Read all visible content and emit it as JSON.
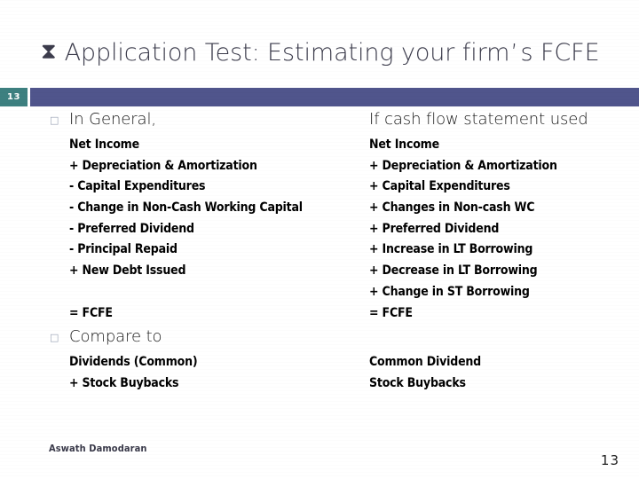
{
  "colors": {
    "header_bar": "#50558C",
    "slide_badge": "#3D8080",
    "title_text": "#3A3A4A",
    "body_text": "#000000",
    "bullet_mark": "#9AA3B5",
    "background": "#FFFFFF"
  },
  "title": {
    "icon": "hourglass-icon",
    "icon_glyph": "⧗",
    "text_before_apostrophe": "Application Test: Estimating your firm",
    "apostrophe": "’",
    "text_after_apostrophe": "s FCFE",
    "full_text": "Application Test: Estimating your firm’s FCFE"
  },
  "slide_badge": {
    "number": "13"
  },
  "left_column": {
    "bullet_glyph": "□",
    "section_one": {
      "heading": "In General,",
      "lines": [
        "Net Income",
        "+ Depreciation & Amortization",
        "- Capital Expenditures",
        "- Change in Non-Cash Working Capital",
        "- Preferred Dividend",
        "- Principal Repaid",
        "+ New Debt Issued",
        "",
        "= FCFE"
      ]
    },
    "section_two": {
      "heading": "Compare to",
      "lines": [
        "Dividends (Common)",
        "+ Stock Buybacks"
      ]
    }
  },
  "right_column": {
    "section_one": {
      "heading": "If cash flow statement used",
      "lines": [
        "Net Income",
        "+ Depreciation & Amortization",
        "+ Capital Expenditures",
        "+ Changes in Non-cash WC",
        "+ Preferred Dividend",
        "+ Increase in LT Borrowing",
        "+ Decrease in LT Borrowing",
        "+ Change in ST Borrowing",
        "= FCFE"
      ]
    },
    "section_two": {
      "lines": [
        "Common Dividend",
        "Stock Buybacks"
      ]
    }
  },
  "footer": {
    "author": "Aswath Damodaran",
    "page_number": "13"
  }
}
